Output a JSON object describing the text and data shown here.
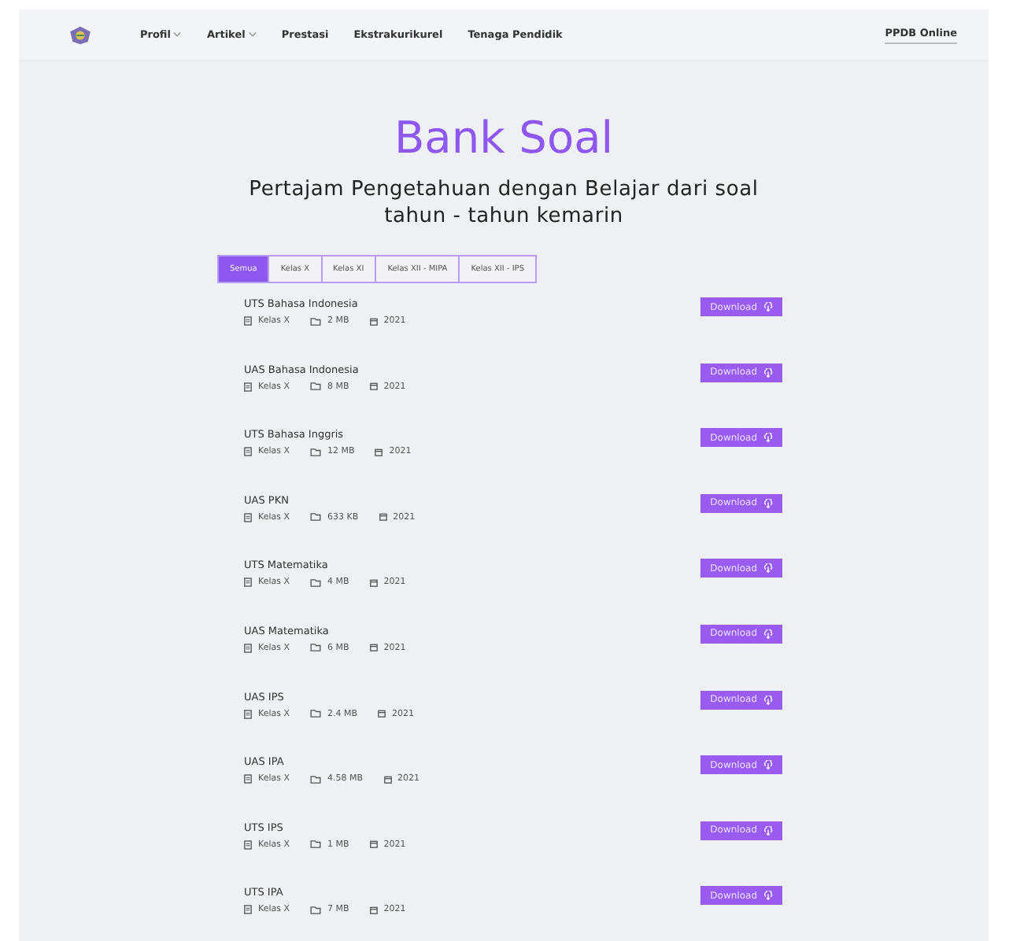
{
  "nav": {
    "items": [
      {
        "label": "Profil",
        "dropdown": true
      },
      {
        "label": "Artikel",
        "dropdown": true
      },
      {
        "label": "Prestasi",
        "dropdown": false
      },
      {
        "label": "Ekstrakurikurel",
        "dropdown": false
      },
      {
        "label": "Tenaga Pendidik",
        "dropdown": false
      }
    ],
    "cta": "PPDB Online"
  },
  "heading": "Bank Soal",
  "subtitle": "Pertajam Pengetahuan dengan Belajar dari soal tahun - tahun kemarin",
  "tabs": [
    {
      "label": "Semua",
      "selected": true
    },
    {
      "label": "Kelas X",
      "selected": false
    },
    {
      "label": "Kelas XI",
      "selected": false
    },
    {
      "label": "Kelas XII - MIPA",
      "selected": false
    },
    {
      "label": "Kelas XII - IPS",
      "selected": false
    }
  ],
  "files": [
    {
      "title": "UTS Bahasa Indonesia",
      "class": "Kelas X",
      "size": "2 MB",
      "year": "2021",
      "button": "Download"
    },
    {
      "title": "UAS Bahasa Indonesia",
      "class": "Kelas X",
      "size": "8 MB",
      "year": "2021",
      "button": "Download"
    },
    {
      "title": "UTS Bahasa Inggris",
      "class": "Kelas X",
      "size": "12 MB",
      "year": "2021",
      "button": "Download"
    },
    {
      "title": "UAS PKN",
      "class": "Kelas X",
      "size": "633 KB",
      "year": "2021",
      "button": "Download"
    },
    {
      "title": "UTS Matematika",
      "class": "Kelas X",
      "size": "4 MB",
      "year": "2021",
      "button": "Download"
    },
    {
      "title": "UAS Matematika",
      "class": "Kelas X",
      "size": "6 MB",
      "year": "2021",
      "button": "Download"
    },
    {
      "title": "UAS IPS",
      "class": "Kelas X",
      "size": "2.4 MB",
      "year": "2021",
      "button": "Download"
    },
    {
      "title": "UAS IPA",
      "class": "Kelas X",
      "size": "4.58 MB",
      "year": "2021",
      "button": "Download"
    },
    {
      "title": "UTS IPS",
      "class": "Kelas X",
      "size": "1 MB",
      "year": "2021",
      "button": "Download"
    },
    {
      "title": "UTS IPA",
      "class": "Kelas X",
      "size": "7 MB",
      "year": "2021",
      "button": "Download"
    }
  ]
}
